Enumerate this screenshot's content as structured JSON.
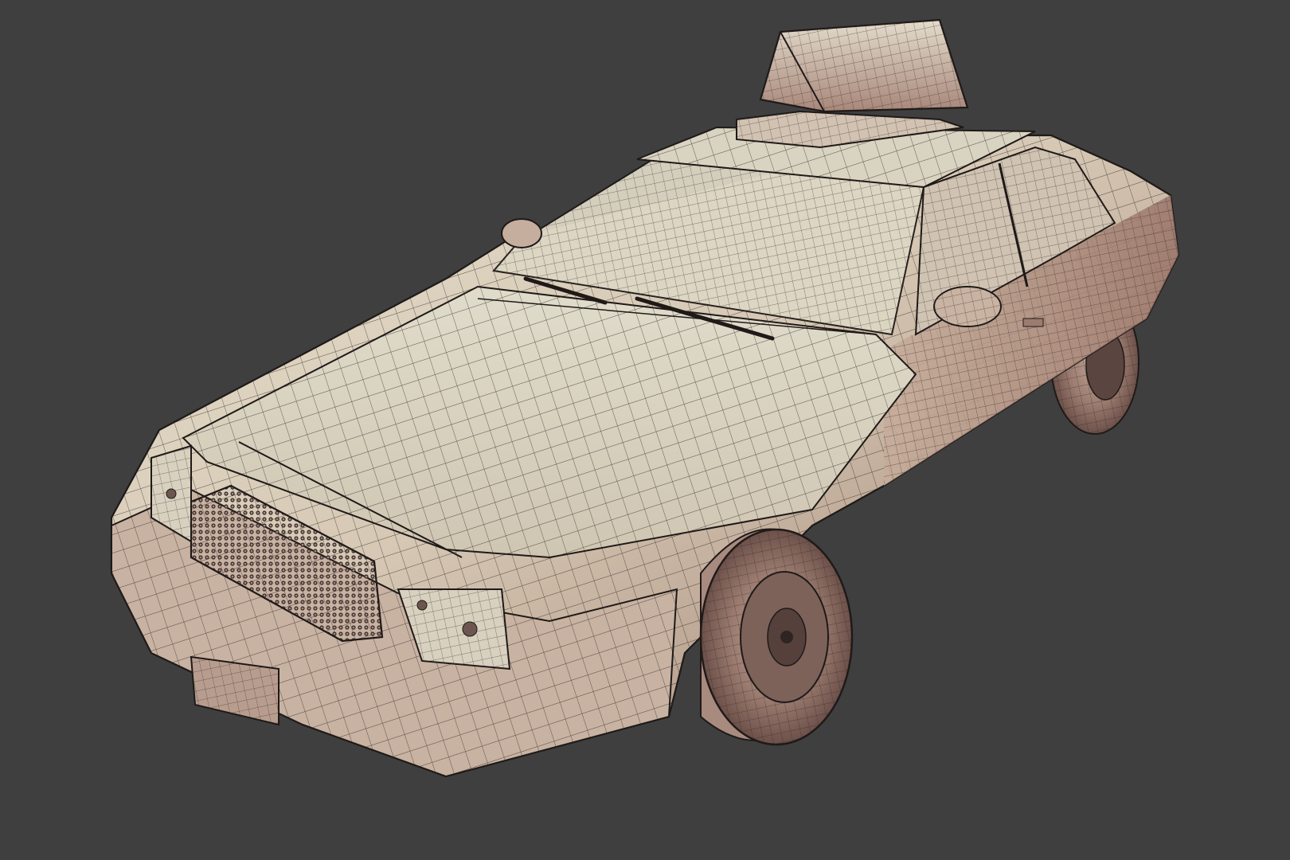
{
  "viewport": {
    "background": "#3f3f3f",
    "shading": "clay-wireframe",
    "model_colors": {
      "light": "#e3ddcb",
      "mid": "#c9b6a3",
      "shadow": "#8f6f63",
      "glass": "#ddd8c4",
      "wire": "#1f1a18",
      "tire": "#8a6c62"
    }
  }
}
